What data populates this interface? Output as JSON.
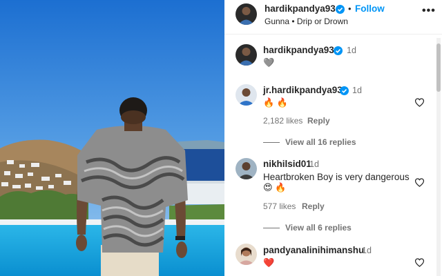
{
  "post": {
    "author": "hardikpandya93",
    "follow_label": "Follow",
    "dot": "•",
    "audio": "Gunna • Drip or Drown",
    "more_glyph": "•••"
  },
  "caption": {
    "username": "hardikpandya93",
    "time": "1d",
    "emoji": "🩶"
  },
  "comments": [
    {
      "username": "jr.hardikpandya93",
      "time": "1d",
      "text": "🔥 🔥",
      "likes": "2,182 likes",
      "reply_label": "Reply",
      "view_replies": "View all 16 replies"
    },
    {
      "username": "nikhilsid01",
      "time": "1d",
      "text": "Heartbroken Boy is very dangerous",
      "emoji": "😍 🔥",
      "likes": "577 likes",
      "reply_label": "Reply",
      "view_replies": "View all 6 replies"
    },
    {
      "username": "pandyanalinihimanshu",
      "time": "1d",
      "text": "❤️"
    }
  ],
  "colors": {
    "link_blue": "#0095f6",
    "verified_blue": "#0095f6",
    "text": "#262626",
    "secondary_text": "#737373"
  }
}
